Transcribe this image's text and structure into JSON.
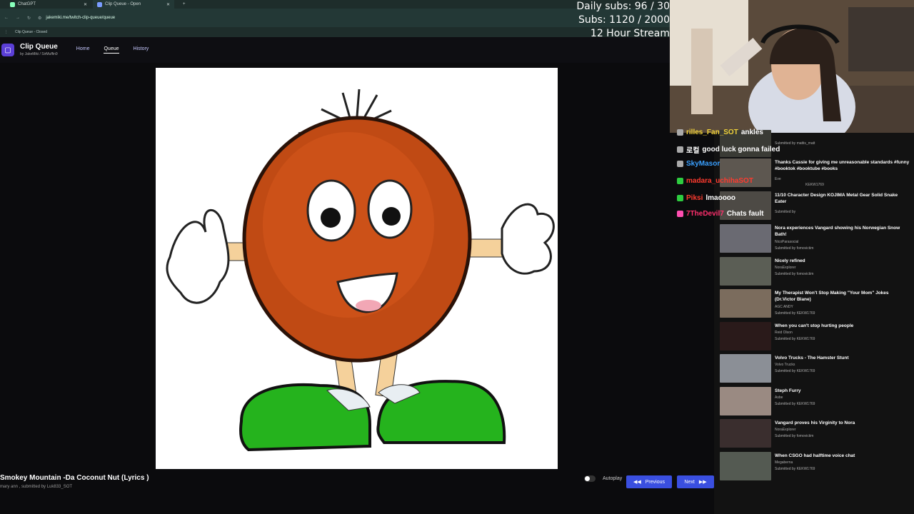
{
  "browser": {
    "tabs": [
      {
        "label": "ChatGPT"
      },
      {
        "label": "Clip Queue - Open"
      }
    ],
    "url": "jakemiki.me/twitch-clip-queue/queue",
    "bookmark": "Clip Queue - Closed"
  },
  "app": {
    "title": "Clip Queue",
    "byline": "by  JakeMiki  /  SirMuffin9",
    "nav": [
      "Home",
      "Queue",
      "History"
    ]
  },
  "stream_overlay": {
    "line1": "Daily subs: 96 / 30",
    "line2": "Subs: 1120 / 2000",
    "line3": "12 Hour Stream"
  },
  "current_clip": {
    "title": "Smokey Mountain -Da Coconut Nut (Lyrics )",
    "meta": "mary ann , submitted by Luk833_SOT"
  },
  "controls": {
    "autoplay": "Autoplay",
    "previous": "Previous",
    "next": "Next"
  },
  "chat": [
    {
      "user": "rilles_Fan_SOT",
      "msg": "ankles",
      "color": "#f2d33a"
    },
    {
      "user": "로컬",
      "msg": "good luck gonna failed",
      "color": "#ffffff"
    },
    {
      "user": "SkyMasor",
      "msg": "",
      "color": "#3aa0ff"
    },
    {
      "user": "madara_uchihaSOT",
      "msg": "",
      "color": "#ff3b2f"
    },
    {
      "user": "Piksi",
      "msg": "lmaoooo",
      "color": "#ff3b2f"
    },
    {
      "user": "7TheDevil7",
      "msg": "Chats fault",
      "color": "#ff2f6d"
    }
  ],
  "queue": [
    {
      "title": "",
      "channel": "",
      "submitter": "Submitted by mattis_matt"
    },
    {
      "title": "Thanks Cassie for giving me unreasonable standards  #funny #booktok #booktube #books",
      "channel": "Eve",
      "submitter": "KEKW1769"
    },
    {
      "title": "11/10 Character Design KOJIMA  Metal Gear Solid Snake Eater",
      "channel": "",
      "submitter": "Submitted by"
    },
    {
      "title": "Nora experiences Vangard showing his Norwegian Snow Bath!",
      "channel": "NicoParasocial",
      "submitter": "Submitted by fomovictim"
    },
    {
      "title": "Nicely refined",
      "channel": "NoraExplorer",
      "submitter": "Submitted by fomovictim"
    },
    {
      "title": "My Therapist Won't Stop Making \"Your Mom\" Jokes (Dr.Victor Blane)",
      "channel": "AGC ANDY",
      "submitter": "Submitted by KEKW1769"
    },
    {
      "title": "When you can't stop hurting people",
      "channel": "Reid Olson",
      "submitter": "Submitted by KEKW1769"
    },
    {
      "title": "Volvo Trucks - The Hamster Stunt",
      "channel": "Volvo Trucks",
      "submitter": "Submitted by KEKW1769"
    },
    {
      "title": "Steph Furry",
      "channel": "Asbe",
      "submitter": "Submitted by KEKW1769"
    },
    {
      "title": "Vangard proves his Virginity to Nora",
      "channel": "NoraExplorer",
      "submitter": "Submitted by fomovictim"
    },
    {
      "title": "When CSGO had halftime voice chat",
      "channel": "Megaberna",
      "submitter": "Submitted by KEKW1769"
    }
  ]
}
